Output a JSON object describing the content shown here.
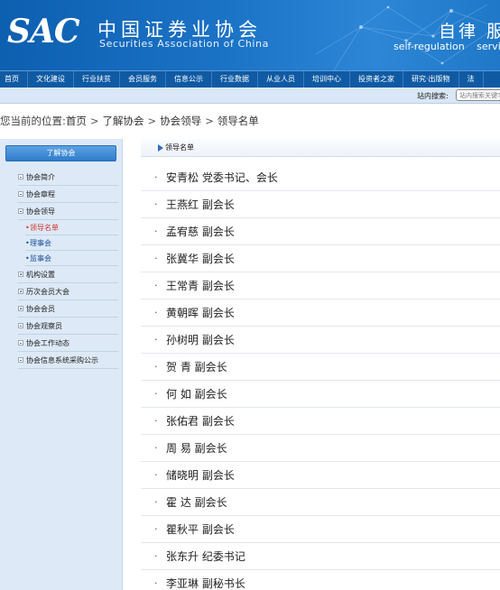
{
  "header": {
    "logo_abbr": "SAC",
    "logo_cn": "中国证券业协会",
    "logo_en": "Securities Association of China",
    "slogan_cn": "自律 服",
    "slogan_en": "self-regulation servic",
    "colors": {
      "banner": "#1b73c6",
      "nav": "#0f5aa3",
      "accent_red": "#d0342c"
    }
  },
  "nav": {
    "items": [
      "首页",
      "文化建设",
      "行业扶贫",
      "会员服务",
      "信息公示",
      "行业数据",
      "从业人员",
      "培训中心",
      "投资者之家",
      "研究·出版物",
      "法"
    ]
  },
  "search": {
    "label": "站内搜索:",
    "placeholder": "站内搜索关键字"
  },
  "breadcrumb": {
    "prefix": "您当前的位置:",
    "items": [
      "首页",
      "了解协会",
      "协会领导",
      "领导名单"
    ],
    "separator": ">"
  },
  "sidebar": {
    "title": "了解协会",
    "items": [
      {
        "label": "协会简介",
        "icon": "minus-box-icon"
      },
      {
        "label": "协会章程",
        "icon": "minus-box-icon"
      },
      {
        "label": "协会领导",
        "icon": "minus-box-icon"
      },
      {
        "label": "领导名单",
        "sub": true,
        "active": true
      },
      {
        "label": "理事会",
        "sub": true
      },
      {
        "label": "监事会",
        "sub": true
      },
      {
        "label": "机构设置",
        "icon": "plus-box-icon"
      },
      {
        "label": "历次会员大会",
        "icon": "plus-box-icon"
      },
      {
        "label": "协会会员",
        "icon": "plus-box-icon"
      },
      {
        "label": "协会观察员",
        "icon": "minus-box-icon"
      },
      {
        "label": "协会工作动态",
        "icon": "minus-box-icon"
      },
      {
        "label": "协会信息系统采购公示",
        "icon": "minus-box-icon"
      }
    ]
  },
  "main": {
    "section_title": "领导名单",
    "leaders": [
      "安青松 党委书记、会长",
      "王燕红 副会长",
      "孟宥慈 副会长",
      "张冀华 副会长",
      "王常青 副会长",
      "黄朝晖 副会长",
      "孙树明 副会长",
      "贺 青 副会长",
      "何 如 副会长",
      "张佑君 副会长",
      "周 易 副会长",
      "储晓明 副会长",
      "霍 达 副会长",
      "瞿秋平 副会长",
      "张东升 纪委书记",
      "李亚琳 副秘书长"
    ]
  }
}
